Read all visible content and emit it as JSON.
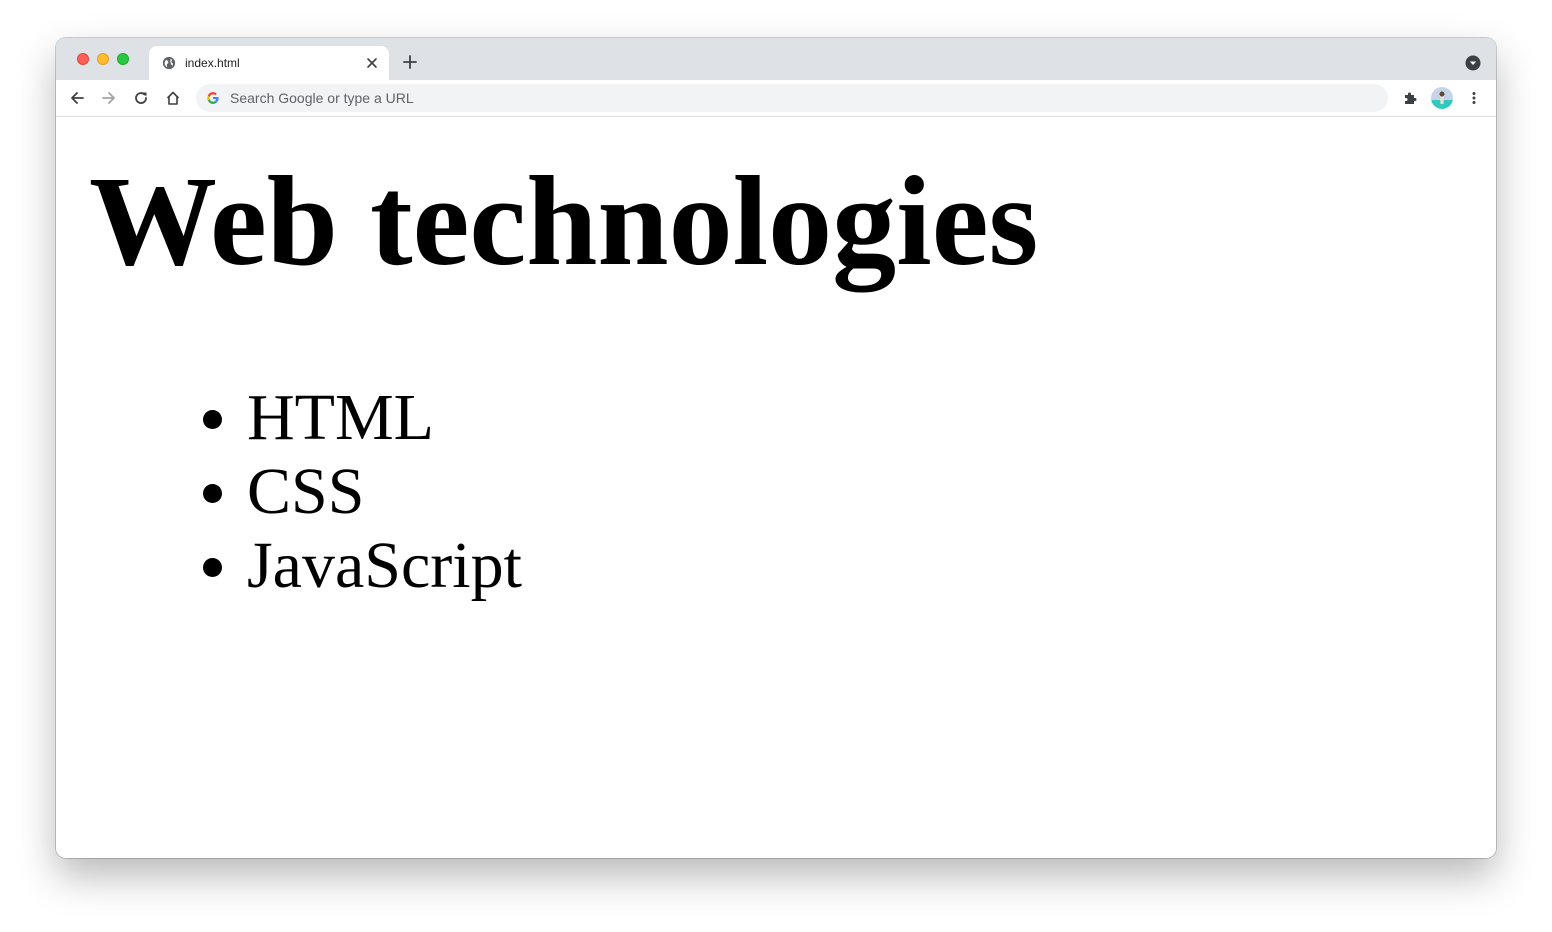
{
  "browser": {
    "tab": {
      "title": "index.html"
    },
    "omnibox": {
      "placeholder": "Search Google or type a URL"
    }
  },
  "page": {
    "heading": "Web technologies",
    "list_items": [
      "HTML",
      "CSS",
      "JavaScript"
    ]
  },
  "colors": {
    "tabstrip": "#dee1e6",
    "omnibox_bg": "#f1f3f4",
    "close": "#fe5f57",
    "minimize": "#febc2e",
    "maximize": "#28c840"
  },
  "icons": [
    "globe-icon",
    "close-icon",
    "plus-icon",
    "tab-search-icon",
    "back-icon",
    "forward-icon",
    "reload-icon",
    "home-icon",
    "google-icon",
    "extensions-icon",
    "avatar",
    "more-icon"
  ]
}
